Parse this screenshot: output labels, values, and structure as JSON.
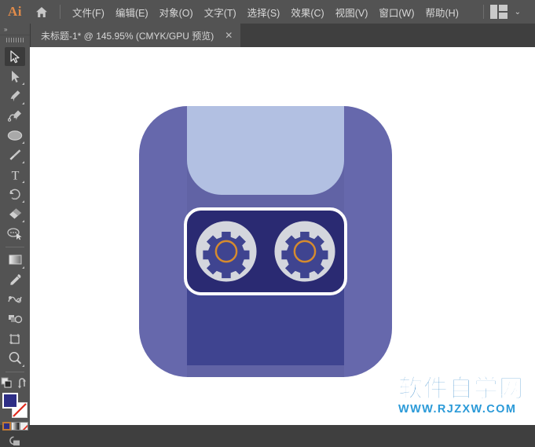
{
  "app": {
    "name": "Ai",
    "logo_color": "#e08b4a"
  },
  "menubar": {
    "home_icon": "home-icon",
    "items": [
      {
        "label": "文件(F)"
      },
      {
        "label": "编辑(E)"
      },
      {
        "label": "对象(O)"
      },
      {
        "label": "文字(T)"
      },
      {
        "label": "选择(S)"
      },
      {
        "label": "效果(C)"
      },
      {
        "label": "视图(V)"
      },
      {
        "label": "窗口(W)"
      },
      {
        "label": "帮助(H)"
      }
    ],
    "workspace_switcher": "workspace-layout-icon",
    "workspace_chevron": "⌄"
  },
  "tabbar": {
    "tab_title": "未标题-1* @ 145.95% (CMYK/GPU 预览)",
    "close_label": "✕"
  },
  "toolbar": {
    "expand_label": "»",
    "tools": [
      {
        "name": "selection-tool",
        "active": true,
        "has_flyout": false
      },
      {
        "name": "direct-selection-tool",
        "active": false,
        "has_flyout": true
      },
      {
        "name": "pen-tool",
        "active": false,
        "has_flyout": true
      },
      {
        "name": "curvature-tool",
        "active": false,
        "has_flyout": false
      },
      {
        "name": "ellipse-tool",
        "active": false,
        "has_flyout": true
      },
      {
        "name": "paintbrush-tool",
        "active": false,
        "has_flyout": true
      },
      {
        "name": "type-tool",
        "active": false,
        "has_flyout": true
      },
      {
        "name": "rotate-tool",
        "active": false,
        "has_flyout": true
      },
      {
        "name": "eraser-tool",
        "active": false,
        "has_flyout": true
      },
      {
        "name": "shape-builder-tool",
        "active": false,
        "has_flyout": false
      },
      {
        "name": "gradient-tool",
        "active": false,
        "has_flyout": true
      },
      {
        "name": "eyedropper-tool",
        "active": false,
        "has_flyout": false
      },
      {
        "name": "blend-tool",
        "active": false,
        "has_flyout": false
      },
      {
        "name": "symbol-sprayer-tool",
        "active": false,
        "has_flyout": false
      },
      {
        "name": "artboard-tool",
        "active": false,
        "has_flyout": false
      },
      {
        "name": "zoom-tool",
        "active": false,
        "has_flyout": true
      }
    ],
    "fill_color": "#2e2e86",
    "stroke_color": "none",
    "swap_icon": "swap-fill-stroke-icon",
    "default_icon": "default-fill-stroke-icon",
    "mini_swatches": [
      "color-swatch",
      "gradient-swatch",
      "none-swatch"
    ],
    "screen_mode_icon": "screen-mode-icon"
  },
  "canvas": {
    "background": "#ffffff",
    "artwork": {
      "name": "robot-app-icon",
      "colors": {
        "body": "#6668ac",
        "middle_panel": "#6163a5",
        "top_visor": "#b2c0e2",
        "bottom_panel": "#3f4490",
        "dark_panel": "#2a2a72",
        "panel_stroke": "#ffffff",
        "gear_disc": "#d4d6dd",
        "gear_inner": "#3f4490",
        "gear_ring": "#d68b2e"
      },
      "gears": [
        {
          "name": "gear-left"
        },
        {
          "name": "gear-right"
        }
      ]
    }
  },
  "watermark": {
    "chinese": "软件自学网",
    "url": "WWW.RJZXW.COM",
    "color_cn": "#1879c4",
    "color_url": "#2b9ad8"
  }
}
